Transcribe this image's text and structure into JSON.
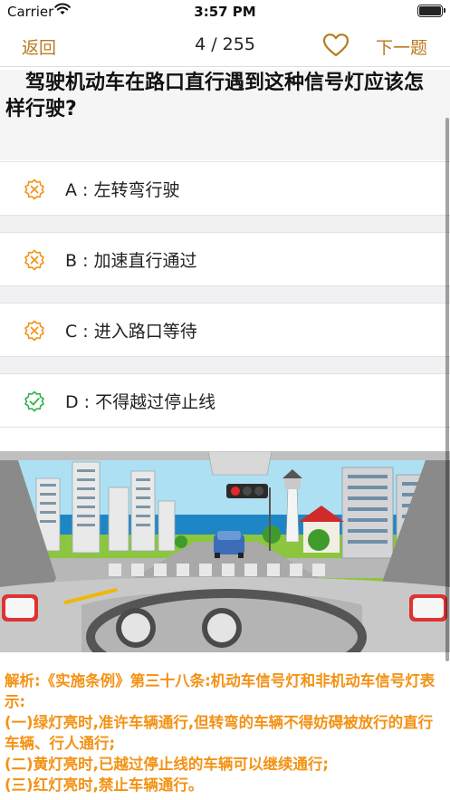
{
  "status_bar": {
    "carrier": "Carrier",
    "time": "3:57 PM"
  },
  "nav": {
    "back_label": "返回",
    "counter": "4 / 255",
    "next_label": "下一题"
  },
  "question": {
    "text": "驾驶机动车在路口直行遇到这种信号灯应该怎样行驶?"
  },
  "options": [
    {
      "label": "A : 左转弯行驶",
      "icon": "x-badge-icon",
      "state": "wrong"
    },
    {
      "label": "B : 加速直行通过",
      "icon": "x-badge-icon",
      "state": "wrong"
    },
    {
      "label": "C : 进入路口等待",
      "icon": "x-badge-icon",
      "state": "wrong"
    },
    {
      "label": "D : 不得越过停止线",
      "icon": "check-badge-icon",
      "state": "correct"
    }
  ],
  "colors": {
    "accent": "#b87a1f",
    "wrong": "#f39214",
    "correct": "#2fb24a",
    "explanation": "#f39214"
  },
  "explanation": {
    "lines": [
      "解析:《实施条例》第三十八条:机动车信号灯和非机动车信号灯表示:",
      "(一)绿灯亮时,准许车辆通行,但转弯的车辆不得妨碍被放行的直行车辆、行人通行;",
      "(二)黄灯亮时,已越过停止线的车辆可以继续通行;",
      "(三)红灯亮时,禁止车辆通行。"
    ]
  }
}
